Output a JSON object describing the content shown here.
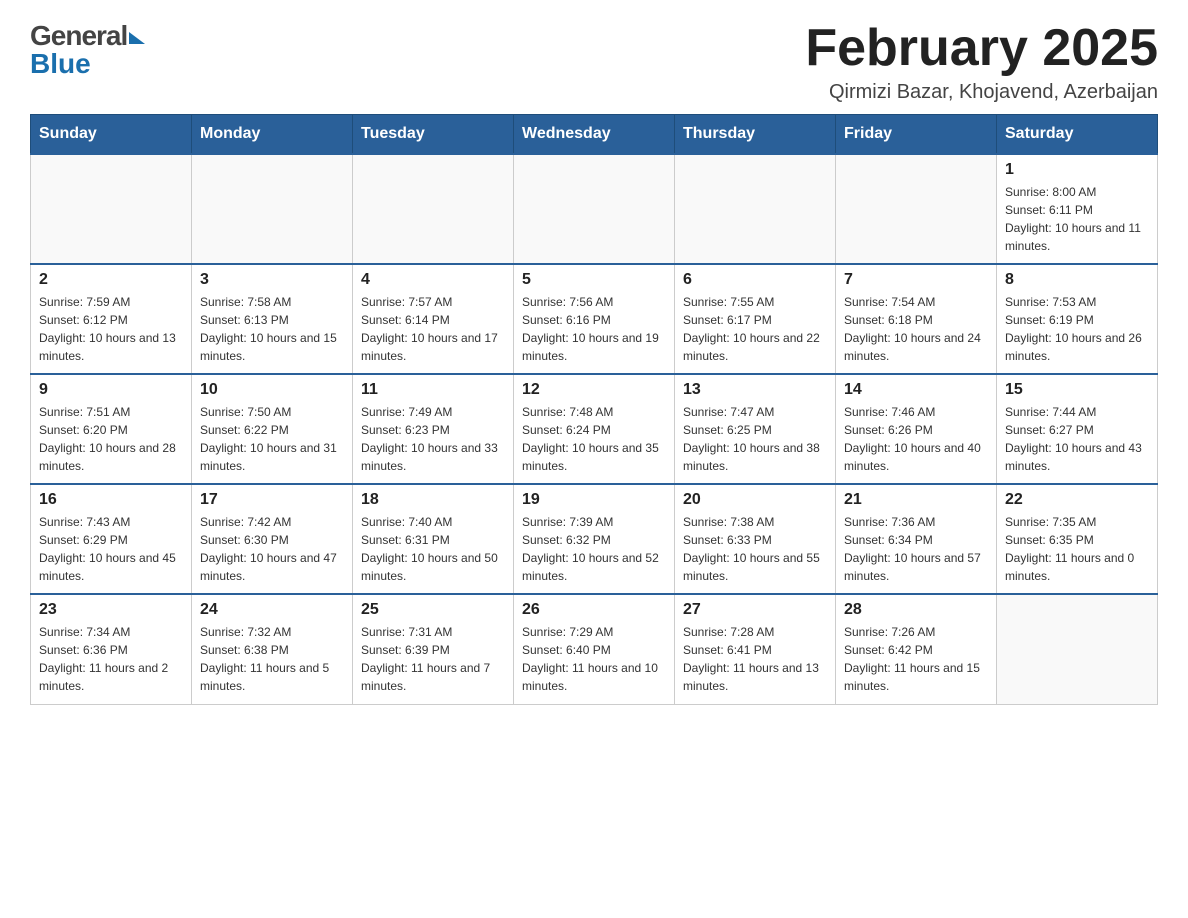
{
  "header": {
    "logo_general": "General",
    "logo_blue": "Blue",
    "month_title": "February 2025",
    "location": "Qirmizi Bazar, Khojavend, Azerbaijan"
  },
  "weekdays": [
    "Sunday",
    "Monday",
    "Tuesday",
    "Wednesday",
    "Thursday",
    "Friday",
    "Saturday"
  ],
  "weeks": [
    [
      {
        "day": "",
        "sunrise": "",
        "sunset": "",
        "daylight": ""
      },
      {
        "day": "",
        "sunrise": "",
        "sunset": "",
        "daylight": ""
      },
      {
        "day": "",
        "sunrise": "",
        "sunset": "",
        "daylight": ""
      },
      {
        "day": "",
        "sunrise": "",
        "sunset": "",
        "daylight": ""
      },
      {
        "day": "",
        "sunrise": "",
        "sunset": "",
        "daylight": ""
      },
      {
        "day": "",
        "sunrise": "",
        "sunset": "",
        "daylight": ""
      },
      {
        "day": "1",
        "sunrise": "Sunrise: 8:00 AM",
        "sunset": "Sunset: 6:11 PM",
        "daylight": "Daylight: 10 hours and 11 minutes."
      }
    ],
    [
      {
        "day": "2",
        "sunrise": "Sunrise: 7:59 AM",
        "sunset": "Sunset: 6:12 PM",
        "daylight": "Daylight: 10 hours and 13 minutes."
      },
      {
        "day": "3",
        "sunrise": "Sunrise: 7:58 AM",
        "sunset": "Sunset: 6:13 PM",
        "daylight": "Daylight: 10 hours and 15 minutes."
      },
      {
        "day": "4",
        "sunrise": "Sunrise: 7:57 AM",
        "sunset": "Sunset: 6:14 PM",
        "daylight": "Daylight: 10 hours and 17 minutes."
      },
      {
        "day": "5",
        "sunrise": "Sunrise: 7:56 AM",
        "sunset": "Sunset: 6:16 PM",
        "daylight": "Daylight: 10 hours and 19 minutes."
      },
      {
        "day": "6",
        "sunrise": "Sunrise: 7:55 AM",
        "sunset": "Sunset: 6:17 PM",
        "daylight": "Daylight: 10 hours and 22 minutes."
      },
      {
        "day": "7",
        "sunrise": "Sunrise: 7:54 AM",
        "sunset": "Sunset: 6:18 PM",
        "daylight": "Daylight: 10 hours and 24 minutes."
      },
      {
        "day": "8",
        "sunrise": "Sunrise: 7:53 AM",
        "sunset": "Sunset: 6:19 PM",
        "daylight": "Daylight: 10 hours and 26 minutes."
      }
    ],
    [
      {
        "day": "9",
        "sunrise": "Sunrise: 7:51 AM",
        "sunset": "Sunset: 6:20 PM",
        "daylight": "Daylight: 10 hours and 28 minutes."
      },
      {
        "day": "10",
        "sunrise": "Sunrise: 7:50 AM",
        "sunset": "Sunset: 6:22 PM",
        "daylight": "Daylight: 10 hours and 31 minutes."
      },
      {
        "day": "11",
        "sunrise": "Sunrise: 7:49 AM",
        "sunset": "Sunset: 6:23 PM",
        "daylight": "Daylight: 10 hours and 33 minutes."
      },
      {
        "day": "12",
        "sunrise": "Sunrise: 7:48 AM",
        "sunset": "Sunset: 6:24 PM",
        "daylight": "Daylight: 10 hours and 35 minutes."
      },
      {
        "day": "13",
        "sunrise": "Sunrise: 7:47 AM",
        "sunset": "Sunset: 6:25 PM",
        "daylight": "Daylight: 10 hours and 38 minutes."
      },
      {
        "day": "14",
        "sunrise": "Sunrise: 7:46 AM",
        "sunset": "Sunset: 6:26 PM",
        "daylight": "Daylight: 10 hours and 40 minutes."
      },
      {
        "day": "15",
        "sunrise": "Sunrise: 7:44 AM",
        "sunset": "Sunset: 6:27 PM",
        "daylight": "Daylight: 10 hours and 43 minutes."
      }
    ],
    [
      {
        "day": "16",
        "sunrise": "Sunrise: 7:43 AM",
        "sunset": "Sunset: 6:29 PM",
        "daylight": "Daylight: 10 hours and 45 minutes."
      },
      {
        "day": "17",
        "sunrise": "Sunrise: 7:42 AM",
        "sunset": "Sunset: 6:30 PM",
        "daylight": "Daylight: 10 hours and 47 minutes."
      },
      {
        "day": "18",
        "sunrise": "Sunrise: 7:40 AM",
        "sunset": "Sunset: 6:31 PM",
        "daylight": "Daylight: 10 hours and 50 minutes."
      },
      {
        "day": "19",
        "sunrise": "Sunrise: 7:39 AM",
        "sunset": "Sunset: 6:32 PM",
        "daylight": "Daylight: 10 hours and 52 minutes."
      },
      {
        "day": "20",
        "sunrise": "Sunrise: 7:38 AM",
        "sunset": "Sunset: 6:33 PM",
        "daylight": "Daylight: 10 hours and 55 minutes."
      },
      {
        "day": "21",
        "sunrise": "Sunrise: 7:36 AM",
        "sunset": "Sunset: 6:34 PM",
        "daylight": "Daylight: 10 hours and 57 minutes."
      },
      {
        "day": "22",
        "sunrise": "Sunrise: 7:35 AM",
        "sunset": "Sunset: 6:35 PM",
        "daylight": "Daylight: 11 hours and 0 minutes."
      }
    ],
    [
      {
        "day": "23",
        "sunrise": "Sunrise: 7:34 AM",
        "sunset": "Sunset: 6:36 PM",
        "daylight": "Daylight: 11 hours and 2 minutes."
      },
      {
        "day": "24",
        "sunrise": "Sunrise: 7:32 AM",
        "sunset": "Sunset: 6:38 PM",
        "daylight": "Daylight: 11 hours and 5 minutes."
      },
      {
        "day": "25",
        "sunrise": "Sunrise: 7:31 AM",
        "sunset": "Sunset: 6:39 PM",
        "daylight": "Daylight: 11 hours and 7 minutes."
      },
      {
        "day": "26",
        "sunrise": "Sunrise: 7:29 AM",
        "sunset": "Sunset: 6:40 PM",
        "daylight": "Daylight: 11 hours and 10 minutes."
      },
      {
        "day": "27",
        "sunrise": "Sunrise: 7:28 AM",
        "sunset": "Sunset: 6:41 PM",
        "daylight": "Daylight: 11 hours and 13 minutes."
      },
      {
        "day": "28",
        "sunrise": "Sunrise: 7:26 AM",
        "sunset": "Sunset: 6:42 PM",
        "daylight": "Daylight: 11 hours and 15 minutes."
      },
      {
        "day": "",
        "sunrise": "",
        "sunset": "",
        "daylight": ""
      }
    ]
  ]
}
